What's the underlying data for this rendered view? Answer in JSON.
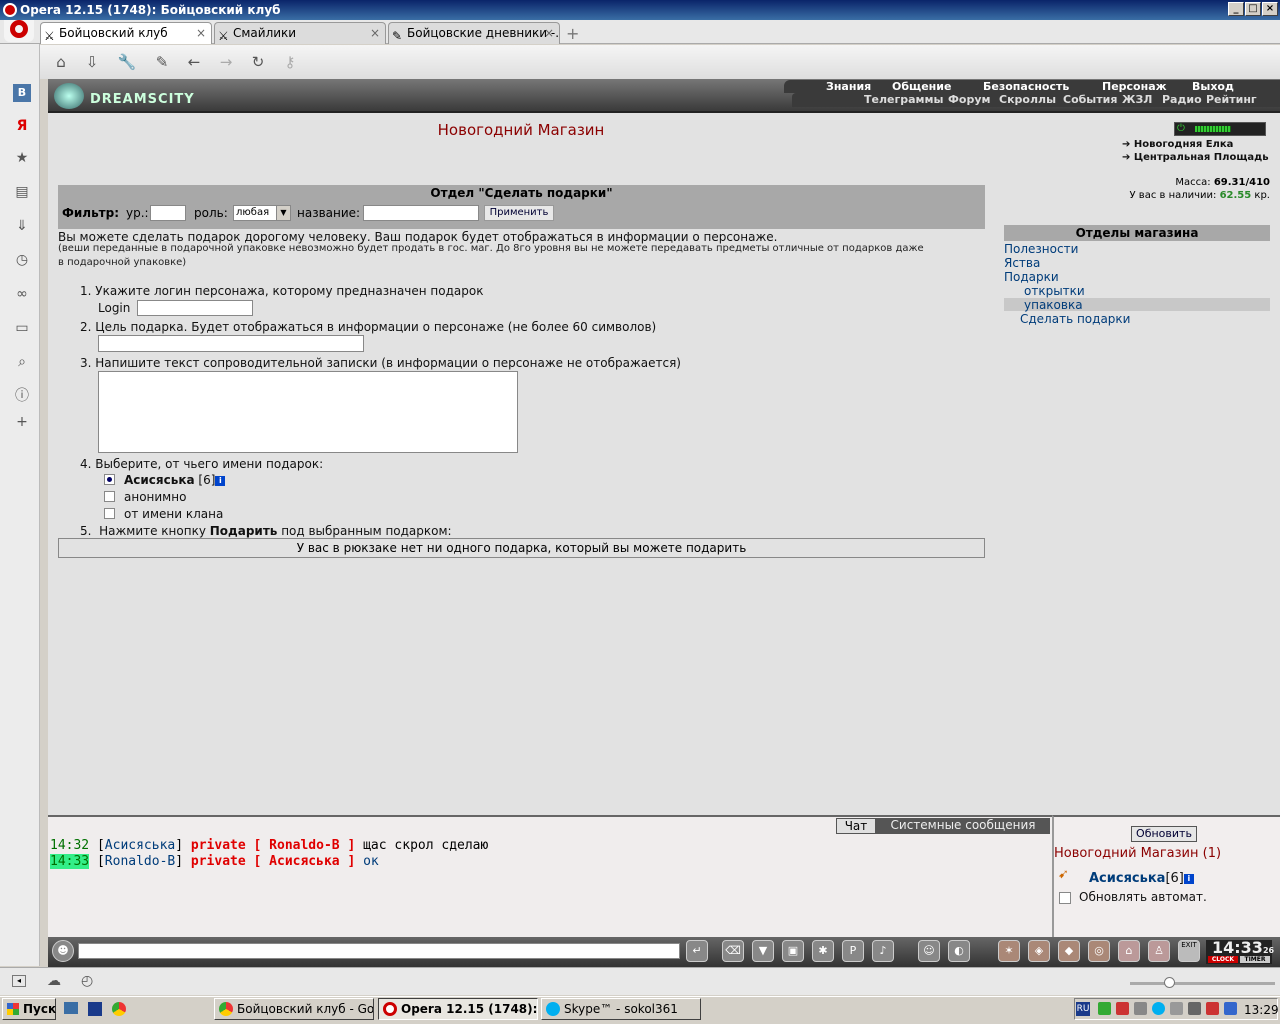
{
  "window": {
    "title": "Opera 12.15 (1748): Бойцовский клуб"
  },
  "tabs": [
    {
      "label": "Бойцовский клуб",
      "icon": "swords-icon"
    },
    {
      "label": "Смайлики",
      "icon": "swords-icon"
    },
    {
      "label": "Бойцовские дневники -...",
      "icon": "pencil-icon"
    }
  ],
  "logo": "DREAMSCITY",
  "top_menu": [
    "Знания",
    "Общение",
    "Безопасность",
    "Персонаж",
    "Выход"
  ],
  "sub_menu": [
    "Телеграммы",
    "Форум",
    "Скроллы",
    "События",
    "ЖЗЛ",
    "Радио",
    "Рейтинг"
  ],
  "shop": {
    "title": "Новогодний Магазин",
    "department_title": "Отдел \"Сделать подарки\"",
    "filter": {
      "label": "Фильтр:",
      "level_label": "ур.:",
      "role_label": "роль:",
      "role_value": "любая",
      "name_label": "название:",
      "apply_button": "Применить"
    },
    "intro": "Вы можете сделать подарок дорогому человеку. Ваш подарок будет отображаться в информации о персонаже.",
    "intro_note_1": "(веши переданные в подарочной упаковке невозможно будет продать в гос. маг. До 8го уровня вы не можете передавать предметы отличные от подарков даже",
    "intro_note_2": "в подарочной упаковке)",
    "steps": {
      "s1": "1.  Укажите логин персонажа, которому предназначен подарок",
      "login_label": "Login",
      "s2": "2.  Цель подарка. Будет отображаться в информации о персонаже (не более 60 символов)",
      "s3": "3.  Напишите текст сопроводительной записки (в информации о персонаже не отображается)",
      "s4": "4.  Выберите, от чьего имени подарок:",
      "s5_pre": "5.  Нажмите кнопку ",
      "s5_bold": "Подарить",
      "s5_post": " под выбранным подарком:"
    },
    "sender_options": {
      "self_name": "Асисяська",
      "self_level": "[6]",
      "anon": "анонимно",
      "clan": "от имени клана"
    },
    "no_gifts": "У вас в рюкзаке нет ни одного подарка, который вы можете подарить"
  },
  "right": {
    "locations": [
      "Новогодняя Елка",
      "Центральная Площадь"
    ],
    "mass_label": "Масса:",
    "mass_value": "69.31/410",
    "money_label": "У вас в наличии:",
    "money_value": "62.55",
    "money_unit": "кр.",
    "departments_title": "Отделы магазина",
    "departments": [
      "Полезности",
      "Яства",
      "Подарки"
    ],
    "sub_departments": [
      "открытки",
      "упаковка"
    ],
    "make_gifts": "Сделать подарки"
  },
  "chat": {
    "tab_chat": "Чат",
    "tab_system": "Системные сообщения",
    "messages": [
      {
        "time": "14:32",
        "from": "Асисяська",
        "private": "private [ Ronaldo-B ]",
        "text": "щас скрол сделаю"
      },
      {
        "time": "14:33",
        "from": "Ronaldo-B",
        "private": "private [ Асисяська ]",
        "text": "ок"
      }
    ]
  },
  "room": {
    "refresh_button": "Обновить",
    "title": "Новогодний Магазин (1)",
    "user_name": "Асисяська",
    "user_level": "[6]",
    "auto_refresh": "Обновлять автомат."
  },
  "clock": {
    "time": "14:33",
    "seconds": "26",
    "clock_label": "CLOCK",
    "timer_label": "TIMER",
    "exit_label": "EXIT"
  },
  "taskbar": {
    "start": "Пуск",
    "tasks": [
      "Бойцовский клуб - Goo...",
      "Opera 12.15 (1748): Б...",
      "Skype™ - sokol361"
    ],
    "lang": "RU",
    "time": "13:29"
  }
}
